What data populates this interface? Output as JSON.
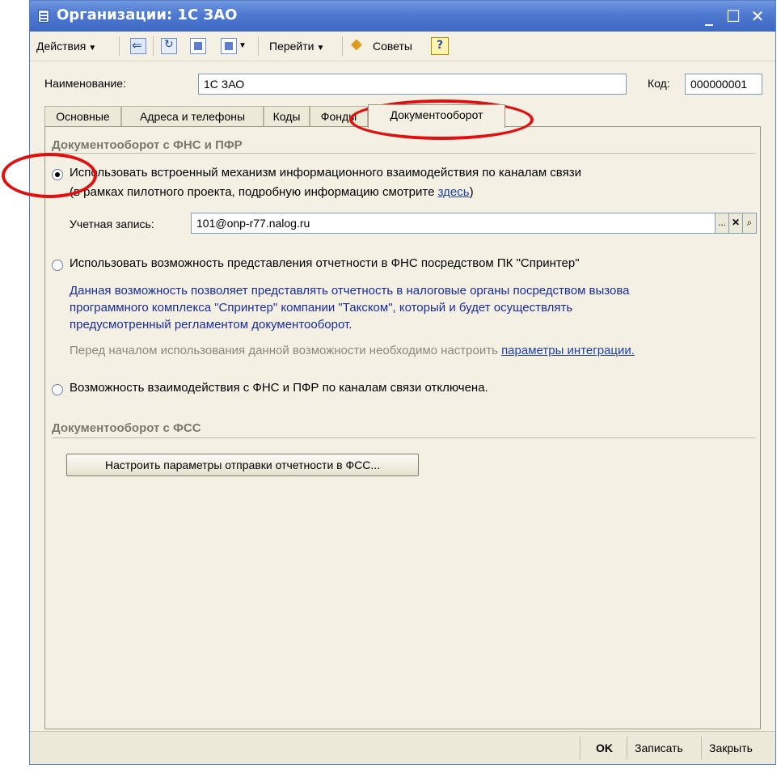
{
  "window": {
    "title": "Организации: 1С ЗАО",
    "controls": {
      "minimize": "_",
      "maximize": "☐",
      "close": "✕"
    }
  },
  "toolbar": {
    "actions_label": "Действия",
    "goto_label": "Перейти",
    "tips_label": "Советы",
    "help_label": "?",
    "icons": [
      "back-icon",
      "refresh-icon",
      "copy-icon",
      "new-document-icon",
      "help-icon"
    ]
  },
  "header": {
    "name_label": "Наименование:",
    "name_value": "1С ЗАО",
    "code_label": "Код:",
    "code_value": "000000001"
  },
  "tabs": [
    {
      "label": "Основные"
    },
    {
      "label": "Адреса и телефоны"
    },
    {
      "label": "Коды"
    },
    {
      "label": "Фонды"
    },
    {
      "label": "Документооборот",
      "active": true
    }
  ],
  "fns": {
    "section_title": "Документооборот с ФНС и ПФР",
    "option1_line1": "Использовать встроенный механизм информационного взаимодействия по каналам связи",
    "option1_line2_prefix": "(в рамках пилотного проекта, подробную информацию смотрите ",
    "option1_link": "здесь",
    "option1_line2_suffix": ")",
    "account_label": "Учетная запись:",
    "account_value": "101@onp-r77.nalog.ru",
    "account_buttons": [
      "...",
      "✕",
      "🔍"
    ],
    "option2_label": "Использовать возможность представления отчетности в ФНС посредством ПК \"Спринтер\"",
    "option2_desc_line1": "Данная возможность позволяет представлять отчетность в налоговые органы посредством вызова",
    "option2_desc_line2": "программного комплекса \"Спринтер\" компании \"Такском\", который и будет осуществлять",
    "option2_desc_line3": "предусмотренный регламентом документооборот.",
    "option2_note_prefix": "Перед началом использования данной возможности необходимо настроить ",
    "option2_note_link": "параметры интеграции.",
    "option3_label": "Возможность взаимодействия с ФНС и ПФР по каналам связи отключена."
  },
  "fss": {
    "section_title": "Документооборот с ФСС",
    "button_label": "Настроить параметры отправки отчетности в ФСС..."
  },
  "footer": {
    "ok_label": "OK",
    "save_label": "Записать",
    "close_label": "Закрыть"
  }
}
